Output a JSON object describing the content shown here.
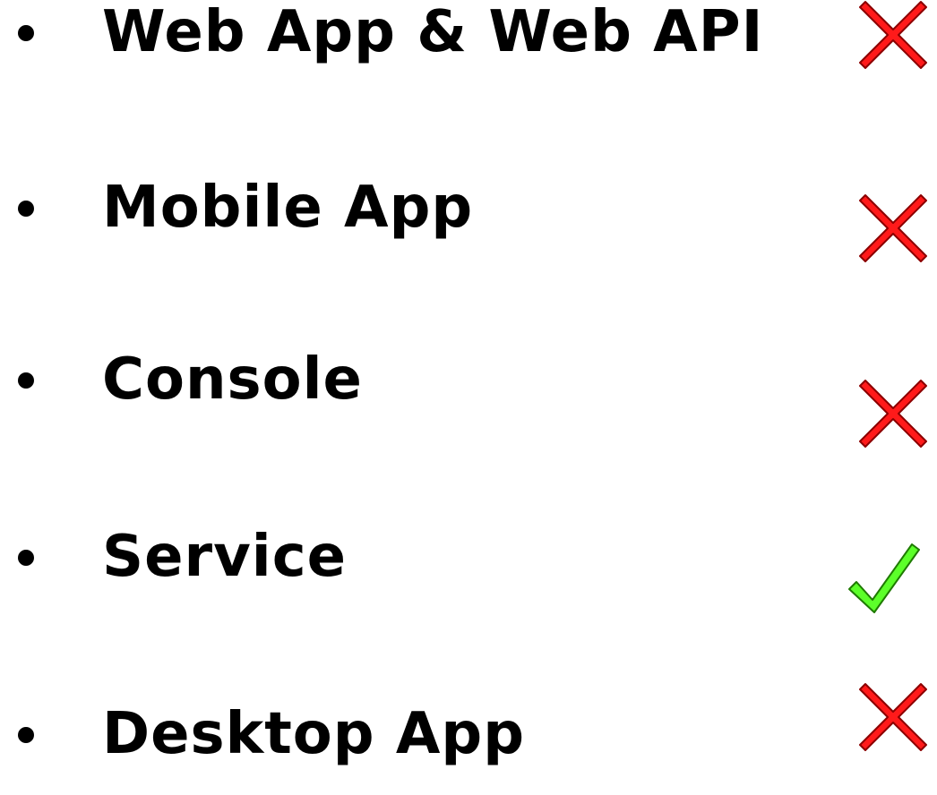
{
  "items": [
    {
      "label": "Web App & Web API",
      "status": "x-icon"
    },
    {
      "label": "Mobile App",
      "status": "x-icon"
    },
    {
      "label": "Console",
      "status": "x-icon"
    },
    {
      "label": "Service",
      "status": "check-icon"
    },
    {
      "label": "Desktop App",
      "status": "x-icon"
    }
  ],
  "colors": {
    "x_mark": "#ff1a1a",
    "x_outline": "#8b0000",
    "check_mark": "#5cff2a",
    "check_outline": "#1e7a00",
    "text": "#000000"
  }
}
